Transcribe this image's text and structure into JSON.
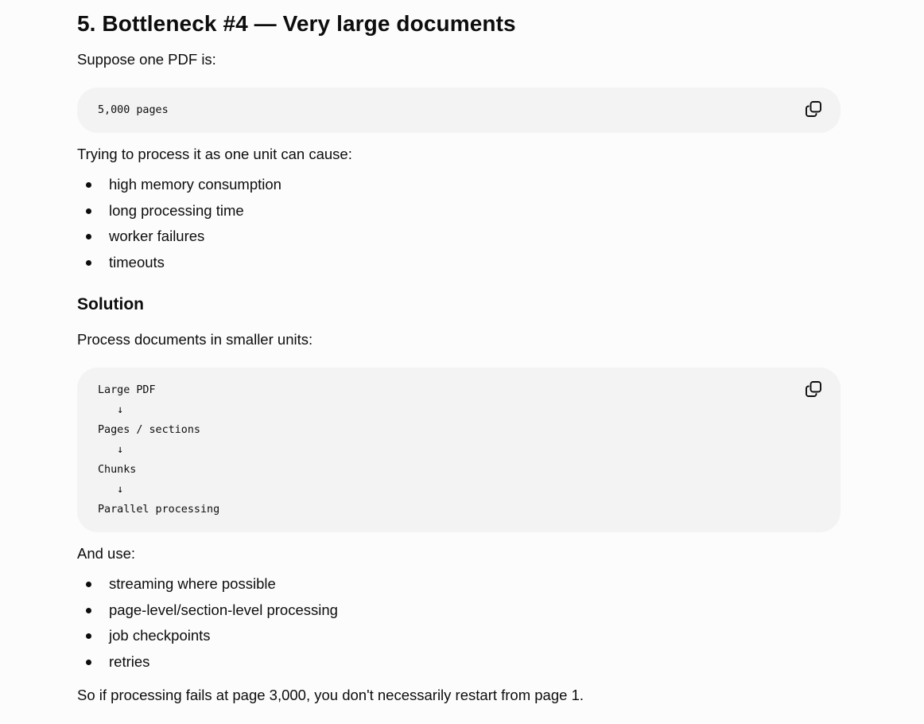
{
  "section": {
    "heading": "5. Bottleneck #4 — Very large documents",
    "intro": "Suppose one PDF is:",
    "code_block_1": {
      "code": "5,000 pages",
      "copy_icon": "copy-icon"
    },
    "problem_intro": "Trying to process it as one unit can cause:",
    "problems": [
      "high memory consumption",
      "long processing time",
      "worker failures",
      "timeouts"
    ],
    "solution_heading": "Solution",
    "solution_intro": "Process documents in smaller units:",
    "code_block_2": {
      "code": "Large PDF\n   ↓\nPages / sections\n   ↓\nChunks\n   ↓\nParallel processing",
      "copy_icon": "copy-icon"
    },
    "use_intro": "And use:",
    "uses": [
      "streaming where possible",
      "page-level/section-level processing",
      "job checkpoints",
      "retries"
    ],
    "conclusion": "So if processing fails at page 3,000, you don't necessarily restart from page 1."
  }
}
